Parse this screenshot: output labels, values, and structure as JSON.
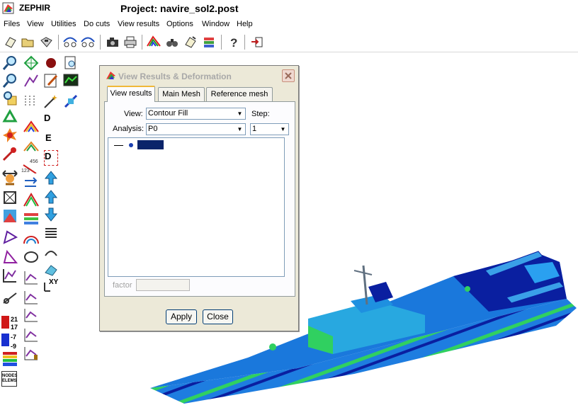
{
  "window": {
    "app_name": "ZEPHIR",
    "project_title": "Project: navire_sol2.post"
  },
  "menu": [
    "Files",
    "View",
    "Utilities",
    "Do cuts",
    "View results",
    "Options",
    "Window",
    "Help"
  ],
  "toolbar_icons": [
    "new-file-icon",
    "open-folder-icon",
    "save-disk-icon",
    "mesh-link-icon",
    "mesh-unlink-icon",
    "camera-icon",
    "print-icon",
    "rainbow-icon",
    "binoculars-icon",
    "notes-icon",
    "layers-icon",
    "help-icon",
    "exit-icon"
  ],
  "palette": {
    "legend_values": [
      "21",
      "17",
      "-7",
      "-9"
    ],
    "nodes_elems_label": [
      "NODES",
      "ELEMS"
    ],
    "numbers_icon_text": "123",
    "numbers_icon_text2": "456",
    "xy_label": "XY",
    "d_label": "D",
    "e_label": "E"
  },
  "dialog": {
    "title": "View Results & Deformation",
    "tabs": [
      "View results",
      "Main Mesh",
      "Reference mesh"
    ],
    "active_tab": "View results",
    "view_label": "View:",
    "view_value": "Contour Fill",
    "step_label": "Step:",
    "step_value": "1",
    "analysis_label": "Analysis:",
    "analysis_value": "P0",
    "tree_selected": "",
    "factor_label": "factor",
    "factor_value": "",
    "apply_label": "Apply",
    "close_label": "Close"
  },
  "colors": {
    "accent_blue": "#0a246a",
    "tab_highlight": "#f0b838",
    "ship_blue": "#1e7de0",
    "ship_dark": "#0a1fa0",
    "ship_green": "#30d060"
  }
}
